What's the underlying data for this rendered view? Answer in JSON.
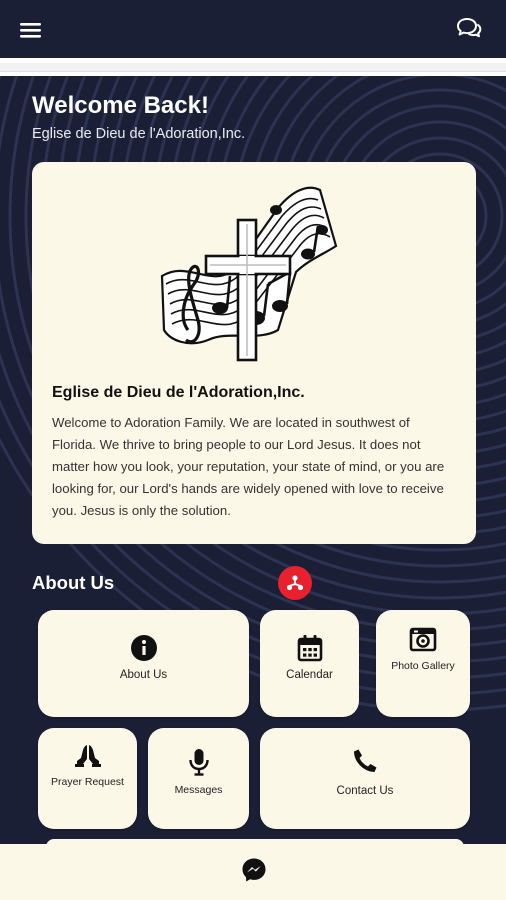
{
  "app": {
    "welcome_title": "Welcome Back!",
    "welcome_subtitle": "Eglise de Dieu de l'Adoration,Inc."
  },
  "header": {
    "menu_icon": "hamburger-menu-icon",
    "chat_icon": "chat-bubbles-icon"
  },
  "intro_card": {
    "logo": "cross-and-music-sheet-logo",
    "title": "Eglise de Dieu de l'Adoration,Inc.",
    "body": "Welcome to Adoration Family. We are located in southwest of Florida. We thrive to bring people to our Lord Jesus. It does not matter how you look, your reputation, your state of mind, or you are looking for, our Lord's hands are widely opened with love to receive you. Jesus is only the solution."
  },
  "about_section": {
    "title": "About Us",
    "tiles": [
      {
        "label": "About Us",
        "icon": "info-icon"
      },
      {
        "label": "Calendar",
        "icon": "calendar-icon"
      },
      {
        "label": "Photo Gallery",
        "icon": "camera-icon"
      },
      {
        "label": "Prayer Request",
        "icon": "praying-hands-icon"
      },
      {
        "label": "Messages",
        "icon": "microphone-icon"
      },
      {
        "label": "Contact Us",
        "icon": "phone-icon"
      }
    ]
  },
  "bottom_bar": {
    "messenger_icon": "messenger-icon"
  },
  "colors": {
    "background": "#1b1f35",
    "card": "#fcf8e8",
    "accent": "#e8212f"
  }
}
